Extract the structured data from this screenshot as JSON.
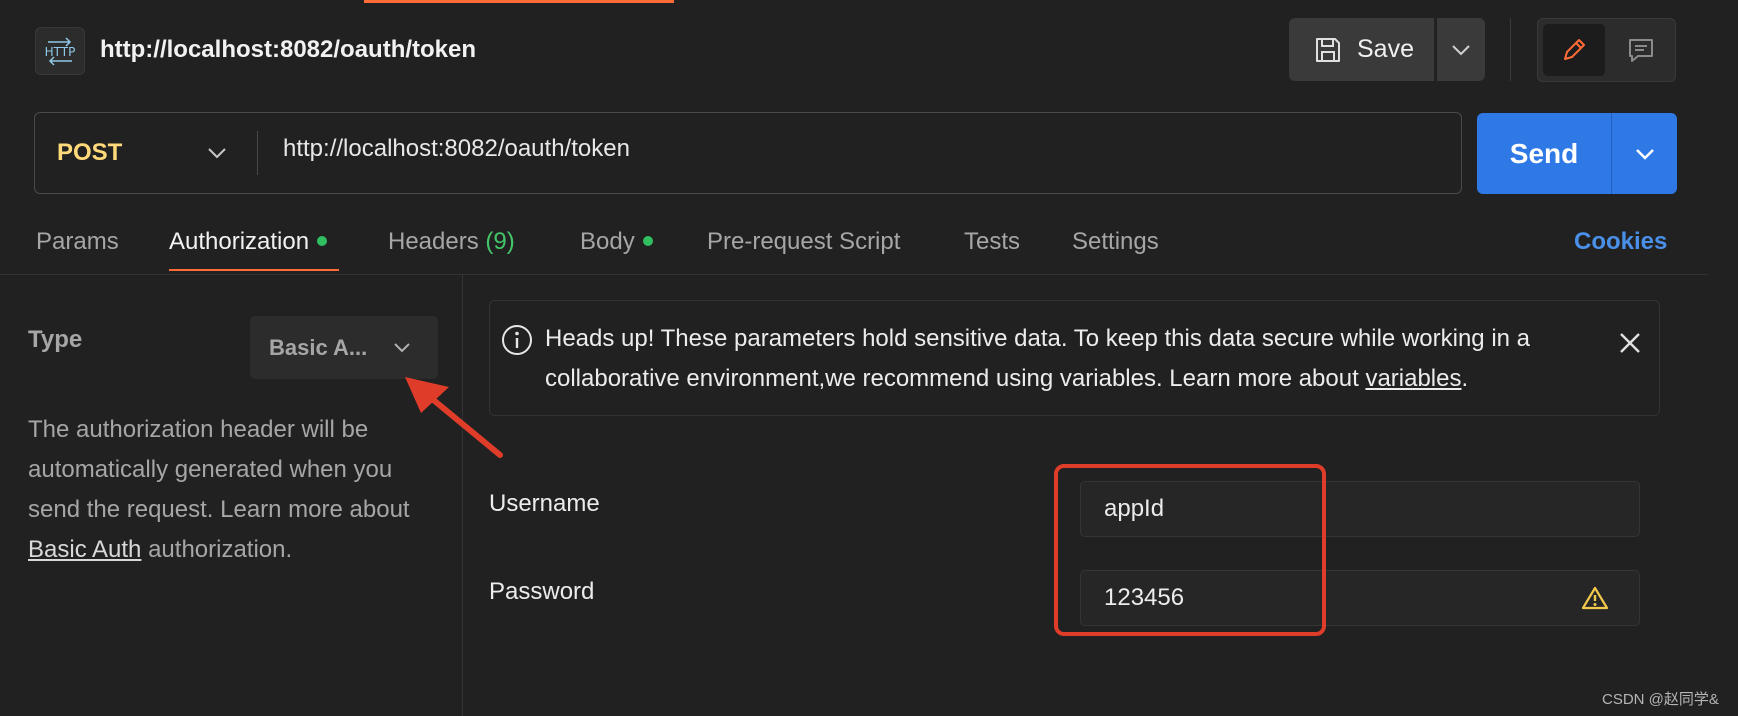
{
  "header": {
    "title": "http://localhost:8082/oauth/token",
    "icon": "http-icon",
    "save_label": "Save"
  },
  "request": {
    "method": "POST",
    "url": "http://localhost:8082/oauth/token",
    "send_label": "Send"
  },
  "tabs": [
    {
      "label": "Params"
    },
    {
      "label": "Authorization"
    },
    {
      "label": "Headers",
      "count": "(9)"
    },
    {
      "label": "Body"
    },
    {
      "label": "Pre-request Script"
    },
    {
      "label": "Tests"
    },
    {
      "label": "Settings"
    }
  ],
  "cookies_label": "Cookies",
  "auth": {
    "type_label": "Type",
    "type_value": "Basic A...",
    "description_pre": "The authorization header will be automatically generated when you send the request. Learn more about ",
    "description_link": "Basic Auth",
    "description_post": " authorization."
  },
  "banner": {
    "text_pre": "Heads up! These parameters hold sensitive data. To keep this data secure while working in a collaborative environment,we recommend using variables. Learn more about ",
    "link": "variables",
    "text_post": "."
  },
  "credentials": {
    "username_label": "Username",
    "username_value": "appId",
    "password_label": "Password",
    "password_value": "123456"
  },
  "watermark": "CSDN @赵同学&",
  "colors": {
    "accent": "#ff6c37",
    "send": "#2f79e6",
    "method": "#ffd97a",
    "status_dot": "#2fbf60",
    "annotation": "#e03c2a"
  }
}
